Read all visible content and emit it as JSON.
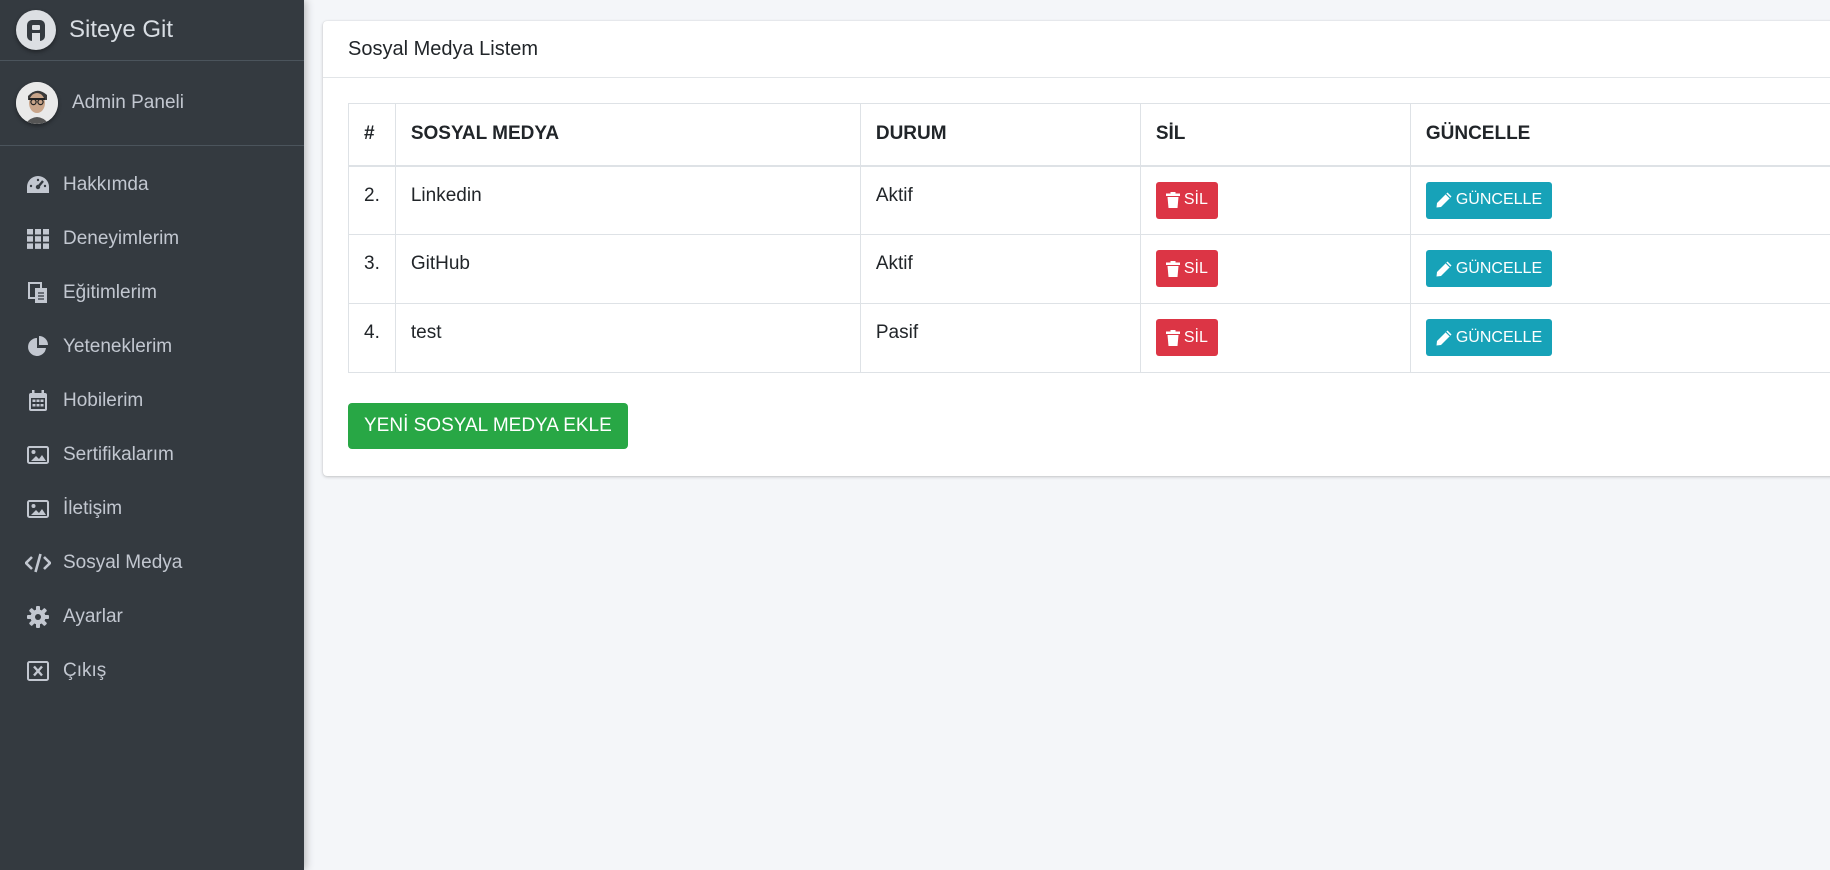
{
  "brand": {
    "title": "Siteye Git",
    "logo_icon": "letter-a-logo-icon"
  },
  "user": {
    "name": "Admin Paneli"
  },
  "sidebar": {
    "items": [
      {
        "label": "Hakkımda",
        "icon": "tachometer-icon"
      },
      {
        "label": "Deneyimlerim",
        "icon": "grid-icon"
      },
      {
        "label": "Eğitimlerim",
        "icon": "copy-icon"
      },
      {
        "label": "Yeteneklerim",
        "icon": "pie-chart-icon"
      },
      {
        "label": "Hobilerim",
        "icon": "calendar-icon"
      },
      {
        "label": "Sertifikalarım",
        "icon": "image-icon"
      },
      {
        "label": "İletişim",
        "icon": "image-icon"
      },
      {
        "label": "Sosyal Medya",
        "icon": "code-icon"
      },
      {
        "label": "Ayarlar",
        "icon": "gear-icon"
      },
      {
        "label": "Çıkış",
        "icon": "close-square-icon"
      }
    ]
  },
  "card": {
    "title": "Sosyal Medya Listem",
    "add_button": "YENİ SOSYAL MEDYA EKLE"
  },
  "table": {
    "headers": [
      "#",
      "SOSYAL MEDYA",
      "DURUM",
      "SİL",
      "GÜNCELLE"
    ],
    "rows": [
      {
        "num": "2.",
        "name": "Linkedin",
        "status": "Aktif",
        "delete": "SİL",
        "update": "GÜNCELLE"
      },
      {
        "num": "3.",
        "name": "GitHub",
        "status": "Aktif",
        "delete": "SİL",
        "update": "GÜNCELLE"
      },
      {
        "num": "4.",
        "name": "test",
        "status": "Pasif",
        "delete": "SİL",
        "update": "GÜNCELLE"
      }
    ]
  },
  "colors": {
    "sidebar_bg": "#343a40",
    "danger": "#dc3545",
    "info": "#17a2b8",
    "success": "#28a745"
  }
}
